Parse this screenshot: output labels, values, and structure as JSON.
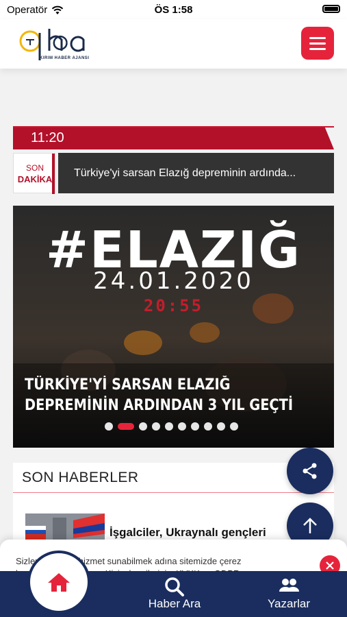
{
  "status_bar": {
    "carrier": "Operatör",
    "time": "ÖS 1:58"
  },
  "header": {
    "logo_text": "qha",
    "logo_subtitle": "KIRIM HABER AJANSI",
    "menu_icon": "hamburger-menu-icon"
  },
  "son_dakika": {
    "time": "11:20",
    "badge_top": "SON",
    "badge_bottom": "DAKİKA",
    "text": "Türkiye'yi sarsan Elazığ depreminin ardında..."
  },
  "slider": {
    "hashtag": "#ELAZIĞ",
    "date": "24.01.2020",
    "clock": "20:55",
    "headline": "TÜRKİYE'Yİ SARSAN ELAZIĞ DEPREMİNİN ARDINDAN 3 YIL GEÇTİ",
    "dot_count": 10,
    "active_dot": 1
  },
  "son_haberler": {
    "title": "SON HABERLER",
    "items": [
      {
        "title": "İşgalciler, Ukraynalı gençleri"
      }
    ]
  },
  "cookie": {
    "line1": "Sizlere daha iyi hizmet sunabilmek adına sitemizde çerez",
    "line2": "konumlandırmaktayız. Kişisel verileriniz, KVKK ve GDPR"
  },
  "bottom_nav": {
    "home_icon": "home-icon",
    "search_label": "Haber Ara",
    "authors_label": "Yazarlar"
  },
  "colors": {
    "accent_red": "#e5243b",
    "dark_red": "#b3102a",
    "navy": "#1a2d5e"
  }
}
